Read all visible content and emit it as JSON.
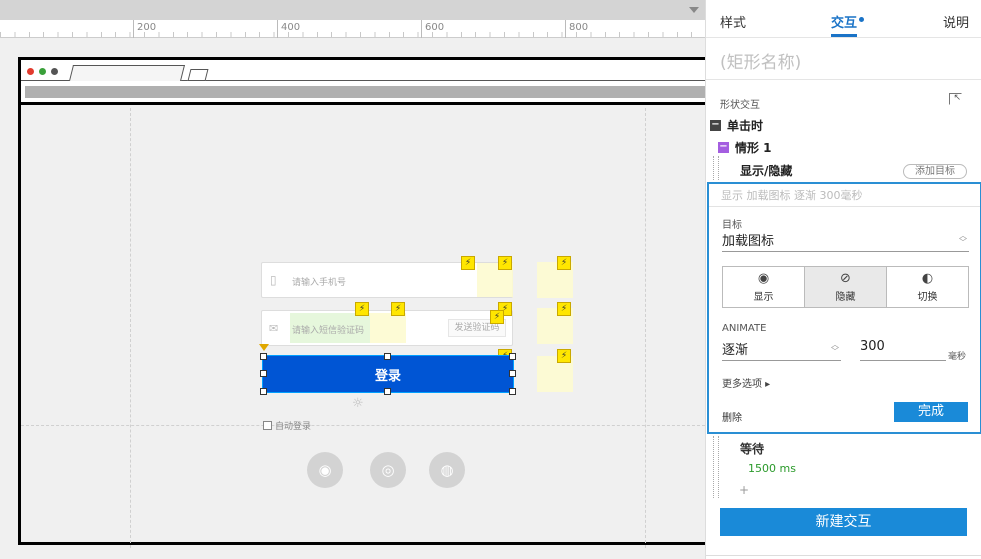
{
  "ruler": {
    "labels": [
      "200",
      "400",
      "600",
      "800"
    ]
  },
  "canvas": {
    "phone_placeholder": "请输入手机号",
    "code_placeholder": "请输入短信验证码",
    "send_code_button": "发送验证码",
    "login_button": "登录",
    "auto_login_label": "自动登录",
    "bolt_glyph": "⚡"
  },
  "panel": {
    "tabs": [
      "样式",
      "交互",
      "说明"
    ],
    "active_tab": "交互",
    "shape_name": "(矩形名称)",
    "section_label": "形状交互",
    "event_label": "单击时",
    "case_label": "情形 1",
    "action_label": "显示/隐藏",
    "add_target_label": "添加目标",
    "action_summary": "显示 加载图标 逐渐 300毫秒",
    "target_label": "目标",
    "target_value": "加载图标",
    "visibility": [
      {
        "label": "显示",
        "icon": "eye-icon",
        "selected": false
      },
      {
        "label": "隐藏",
        "icon": "eye-hidden-icon",
        "selected": true
      },
      {
        "label": "切换",
        "icon": "eye-toggle-icon",
        "selected": false
      }
    ],
    "animate_label": "ANIMATE",
    "animate_value": "逐渐",
    "duration_value": "300",
    "duration_unit": "毫秒",
    "more_options": "更多选项 ▸",
    "delete_label": "删除",
    "done_label": "完成",
    "wait_label": "等待",
    "wait_value": "1500 ms",
    "add_plus": "+",
    "new_interaction_label": "新建交互"
  },
  "colors": {
    "accent": "#1a8ad8",
    "login_button": "#0055d4",
    "bolt": "#ffe600",
    "wait_value": "#2b9a2b"
  }
}
